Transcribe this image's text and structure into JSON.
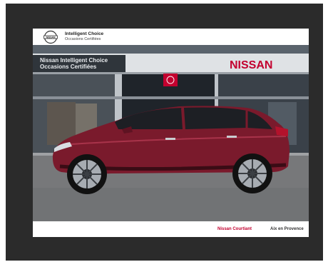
{
  "header": {
    "title": "Intelligent Choice",
    "subtitle": "Occasions Certifiées",
    "logo_icon": "nissan-logo-icon"
  },
  "storefront": {
    "sign_left_line1": "Nissan Intelligent Choice",
    "sign_left_line2": "Occasions Certifiées",
    "sign_right": "NISSAN"
  },
  "vehicle": {
    "color": "#7a1a2c",
    "icon": "car-side-icon"
  },
  "footer": {
    "dealer": "Nissan Courtiant",
    "city": "Aix en Provence"
  },
  "colors": {
    "brand_red": "#c3002f",
    "frame": "#2b2b2b"
  }
}
